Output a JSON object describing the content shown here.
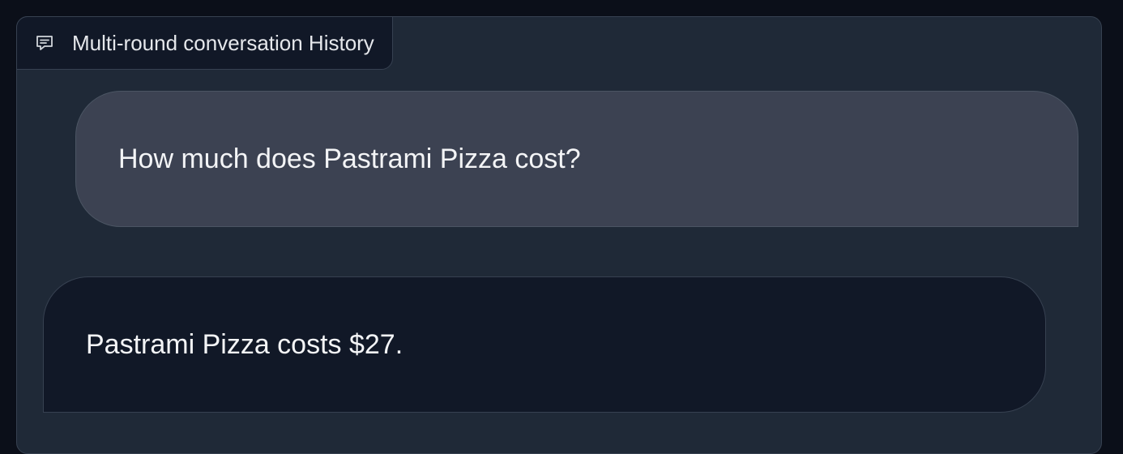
{
  "panel": {
    "label": "Multi-round conversation History",
    "icon": "chat-icon"
  },
  "messages": [
    {
      "role": "user",
      "text": "How much does Pastrami Pizza cost?"
    },
    {
      "role": "bot",
      "text": "Pastrami Pizza costs $27."
    }
  ],
  "colors": {
    "background": "#0b0f19",
    "panel": "#1f2937",
    "user_bubble": "#3c4252",
    "bot_bubble": "#111827",
    "text": "#f3f4f6"
  }
}
